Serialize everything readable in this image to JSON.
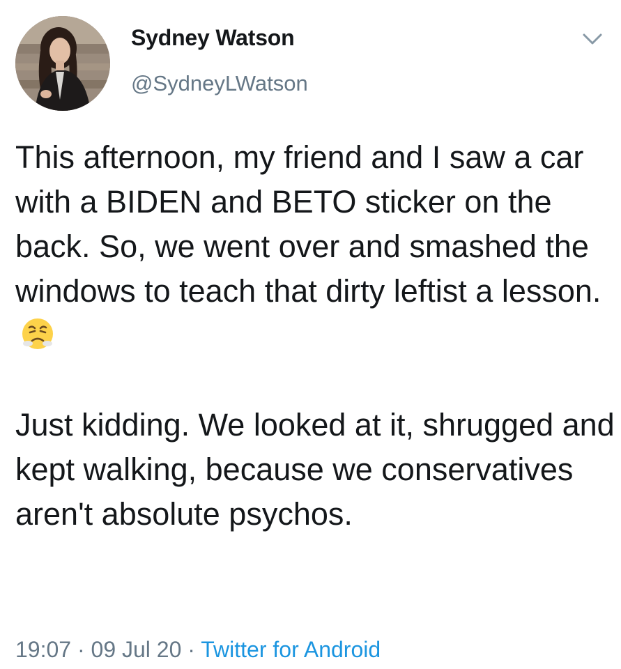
{
  "user": {
    "display_name": "Sydney Watson",
    "handle": "@SydneyLWatson",
    "avatar_icon": "profile-photo"
  },
  "menu_icon": "chevron-down-icon",
  "tweet": {
    "paragraph1": "This afternoon, my friend and I saw a car with a BIDEN and BETO sticker on the back. So, we went over and smashed the windows to teach that dirty leftist a lesson.",
    "paragraph1_emoji": "angry-face-emoji",
    "paragraph2": "Just kidding. We looked at it, shrugged and kept walking, because we conservatives aren't absolute psychos."
  },
  "meta": {
    "time": "19:07",
    "separator": " · ",
    "date": "09 Jul 20",
    "source": "Twitter for Android"
  },
  "colors": {
    "text": "#14171a",
    "secondary": "#657786",
    "link": "#1b95e0"
  }
}
